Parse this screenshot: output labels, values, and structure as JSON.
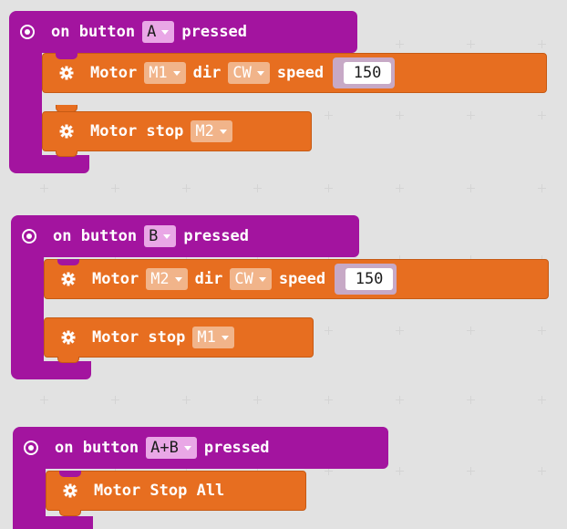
{
  "colors": {
    "event_block": "#a3149f",
    "motor_block": "#e76e20",
    "event_dropdown": "#e9a7e6",
    "motor_dropdown": "#f1b48a",
    "background": "#f6f6f6"
  },
  "events": [
    {
      "prefix": "on button",
      "button": "A",
      "suffix": "pressed",
      "statements": [
        {
          "icon": "gear-icon",
          "word1": "Motor",
          "motor": "M1",
          "word2": "dir",
          "dir": "CW",
          "word3": "speed",
          "speed": "150"
        },
        {
          "icon": "gear-icon",
          "word1": "Motor stop",
          "motor": "M2"
        }
      ]
    },
    {
      "prefix": "on button",
      "button": "B",
      "suffix": "pressed",
      "statements": [
        {
          "icon": "gear-icon",
          "word1": "Motor",
          "motor": "M2",
          "word2": "dir",
          "dir": "CW",
          "word3": "speed",
          "speed": "150"
        },
        {
          "icon": "gear-icon",
          "word1": "Motor stop",
          "motor": "M1"
        }
      ]
    },
    {
      "prefix": "on button",
      "button": "A+B",
      "suffix": "pressed",
      "statements": [
        {
          "icon": "gear-icon",
          "word1": "Motor Stop All"
        }
      ]
    }
  ]
}
